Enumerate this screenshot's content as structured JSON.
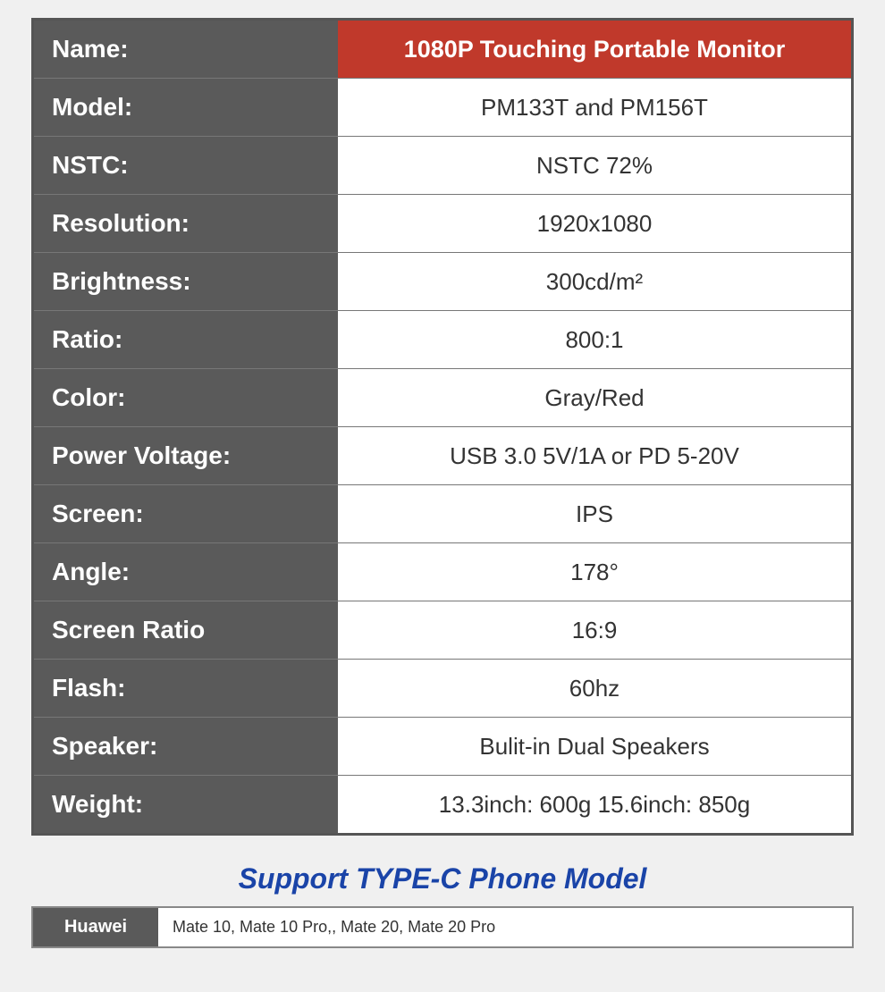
{
  "specTable": {
    "rows": [
      {
        "id": "name",
        "label": "Name:",
        "value": "1080P Touching Portable Monitor",
        "highlight": true
      },
      {
        "id": "model",
        "label": "Model:",
        "value": "PM133T and PM156T",
        "highlight": false
      },
      {
        "id": "nstc",
        "label": "NSTC:",
        "value": "NSTC 72%",
        "highlight": false
      },
      {
        "id": "resolution",
        "label": "Resolution:",
        "value": "1920x1080",
        "highlight": false
      },
      {
        "id": "brightness",
        "label": "Brightness:",
        "value": "300cd/m²",
        "highlight": false
      },
      {
        "id": "ratio",
        "label": "Ratio:",
        "value": "800:1",
        "highlight": false
      },
      {
        "id": "color",
        "label": "Color:",
        "value": "Gray/Red",
        "highlight": false
      },
      {
        "id": "power-voltage",
        "label": "Power Voltage:",
        "value": "USB 3.0 5V/1A or PD 5-20V",
        "highlight": false
      },
      {
        "id": "screen",
        "label": "Screen:",
        "value": "IPS",
        "highlight": false
      },
      {
        "id": "angle",
        "label": "Angle:",
        "value": "178°",
        "highlight": false
      },
      {
        "id": "screen-ratio",
        "label": "Screen Ratio",
        "value": "16:9",
        "highlight": false
      },
      {
        "id": "flash",
        "label": "Flash:",
        "value": "60hz",
        "highlight": false
      },
      {
        "id": "speaker",
        "label": "Speaker:",
        "value": "Bulit-in Dual Speakers",
        "highlight": false
      },
      {
        "id": "weight",
        "label": "Weight:",
        "value": "13.3inch: 600g  15.6inch: 850g",
        "highlight": false
      }
    ]
  },
  "supportSection": {
    "title": "Support TYPE-C Phone Model",
    "rows": [
      {
        "brand": "Huawei",
        "models": "Mate 10, Mate 10 Pro,, Mate 20, Mate 20 Pro"
      }
    ]
  }
}
